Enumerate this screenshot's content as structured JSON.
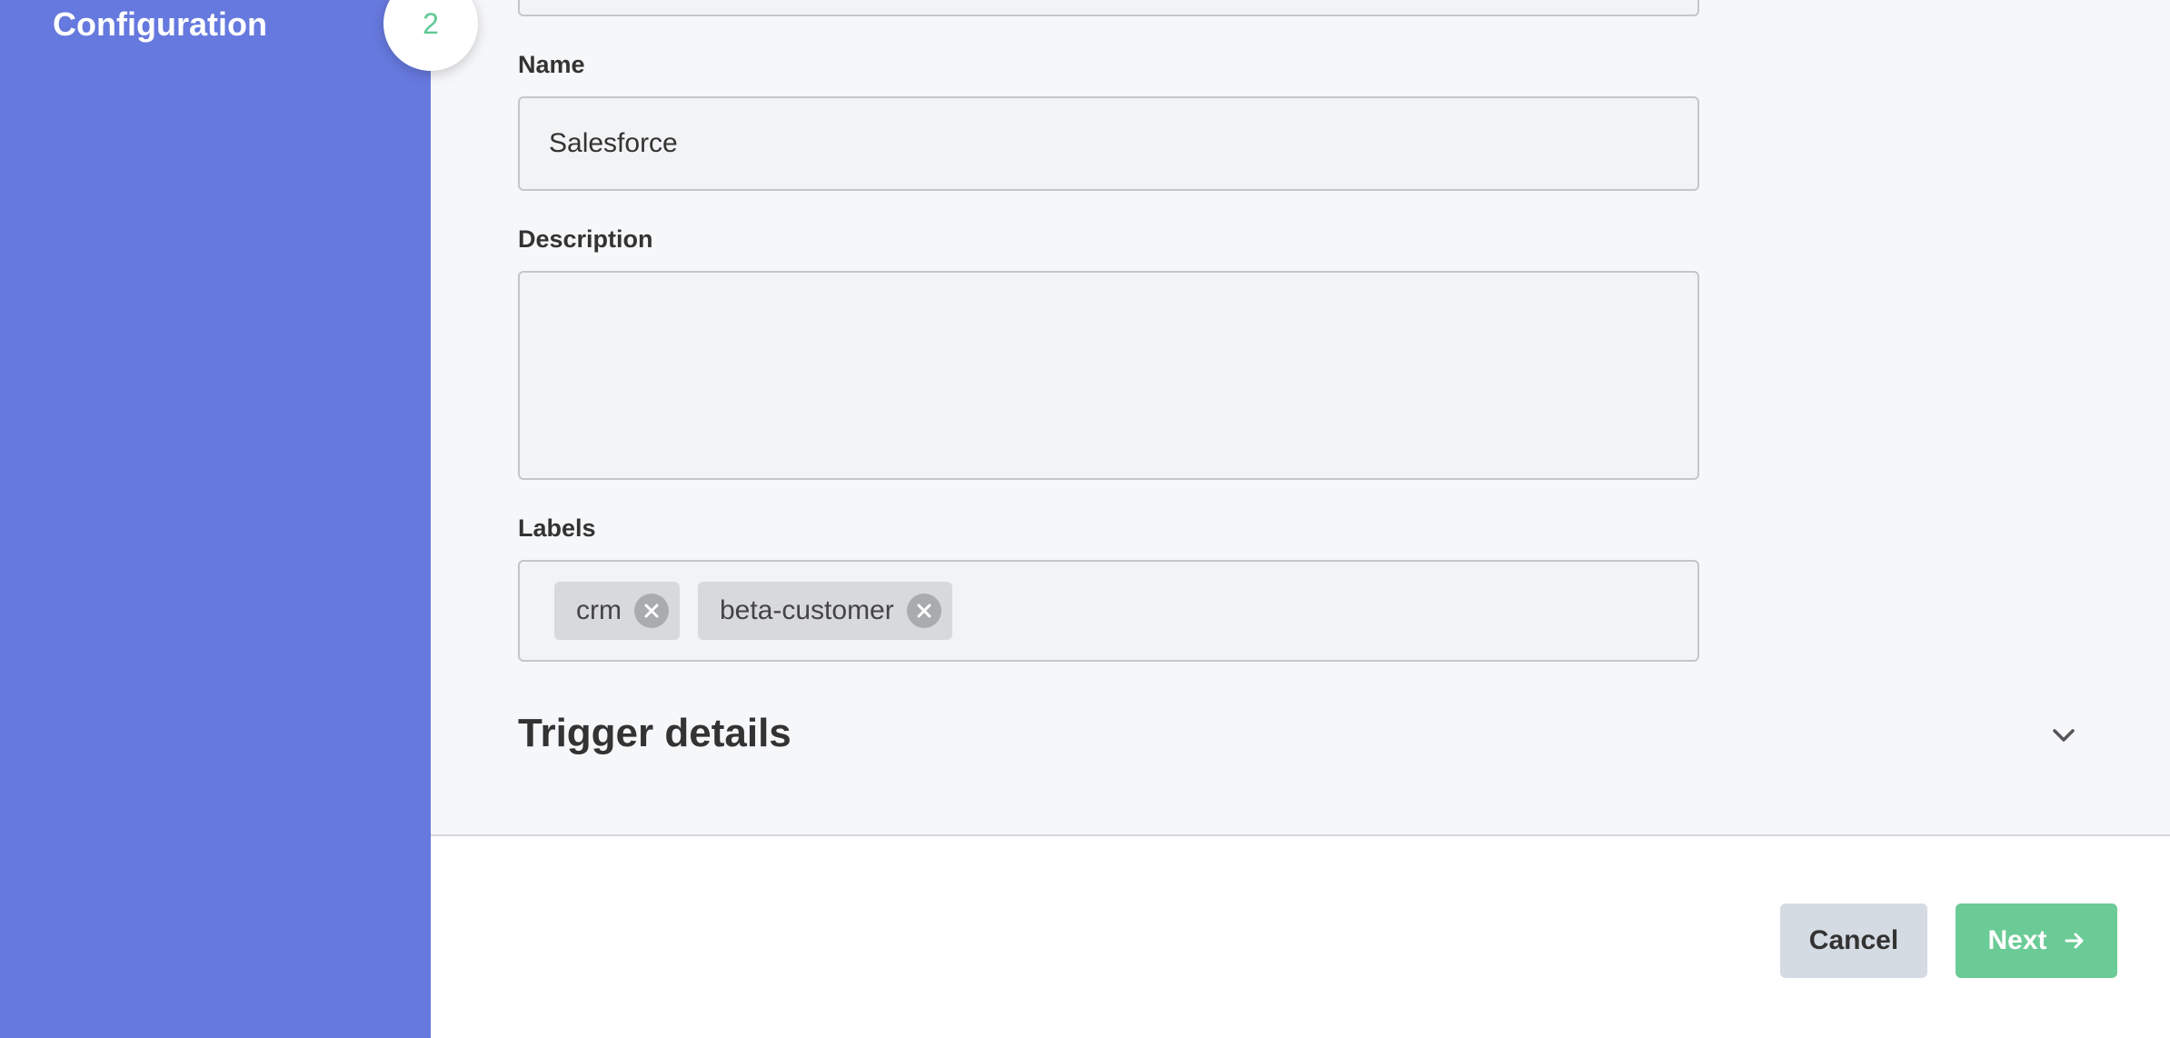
{
  "wizard": {
    "current_step_title": "Configuration",
    "current_step_number": "2"
  },
  "form": {
    "name_label": "Name",
    "name_value": "Salesforce",
    "description_label": "Description",
    "description_value": "",
    "labels_label": "Labels",
    "labels": [
      {
        "text": "crm"
      },
      {
        "text": "beta-customer"
      }
    ],
    "trigger_section_title": "Trigger details"
  },
  "footer": {
    "cancel_label": "Cancel",
    "next_label": "Next"
  },
  "colors": {
    "sidebar": "#6679de",
    "accent_green": "#6bcb96",
    "step_number": "#5fc993"
  },
  "icons": {
    "chip_remove": "close-circle-icon",
    "section_toggle": "chevron-down-icon",
    "next_arrow": "arrow-right-icon"
  }
}
